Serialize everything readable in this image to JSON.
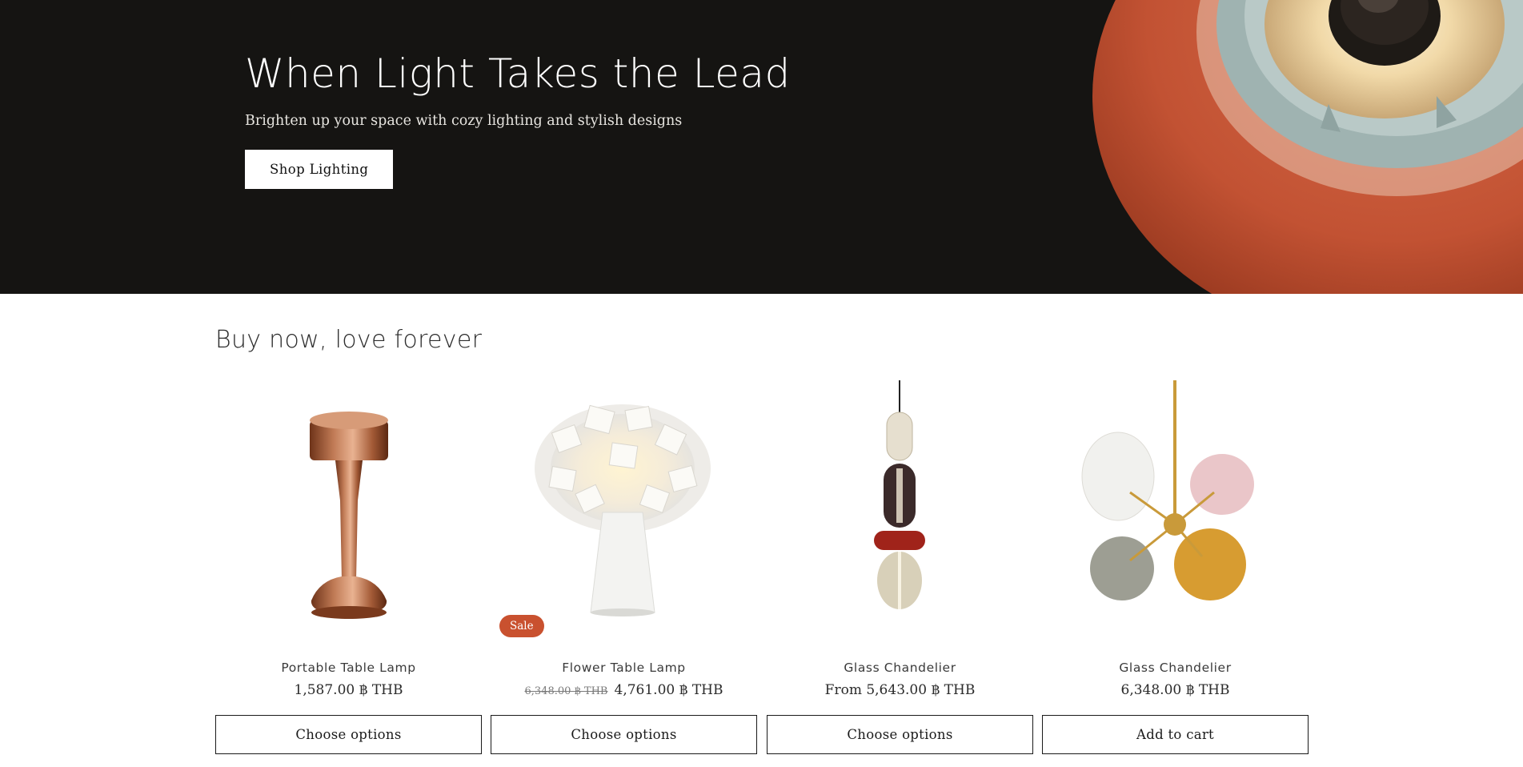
{
  "hero": {
    "title": "When Light Takes the Lead",
    "subtitle": "Brighten up your space with cozy lighting and stylish designs",
    "button_label": "Shop Lighting"
  },
  "collection": {
    "title": "Buy now, love forever",
    "products": [
      {
        "title": "Portable Table Lamp",
        "price": "1,587.00 ฿ THB",
        "compare_price": "",
        "badge": "",
        "button_label": "Choose options",
        "image": "copper-table-lamp"
      },
      {
        "title": "Flower Table Lamp",
        "price": "4,761.00 ฿ THB",
        "compare_price": "6,348.00 ฿ THB",
        "badge": "Sale",
        "button_label": "Choose options",
        "image": "flower-table-lamp"
      },
      {
        "title": "Glass Chandelier",
        "price": "From 5,643.00 ฿ THB",
        "compare_price": "",
        "badge": "",
        "button_label": "Choose options",
        "image": "stacked-glass-pendant"
      },
      {
        "title": "Glass Chandelier",
        "price": "6,348.00 ฿ THB",
        "compare_price": "",
        "badge": "",
        "button_label": "Add to cart",
        "image": "bubble-glass-chandelier"
      }
    ]
  },
  "colors": {
    "hero_background": "#151412",
    "sale_badge": "#c9512f",
    "lamp_shade_terracotta": "#c4583a"
  }
}
